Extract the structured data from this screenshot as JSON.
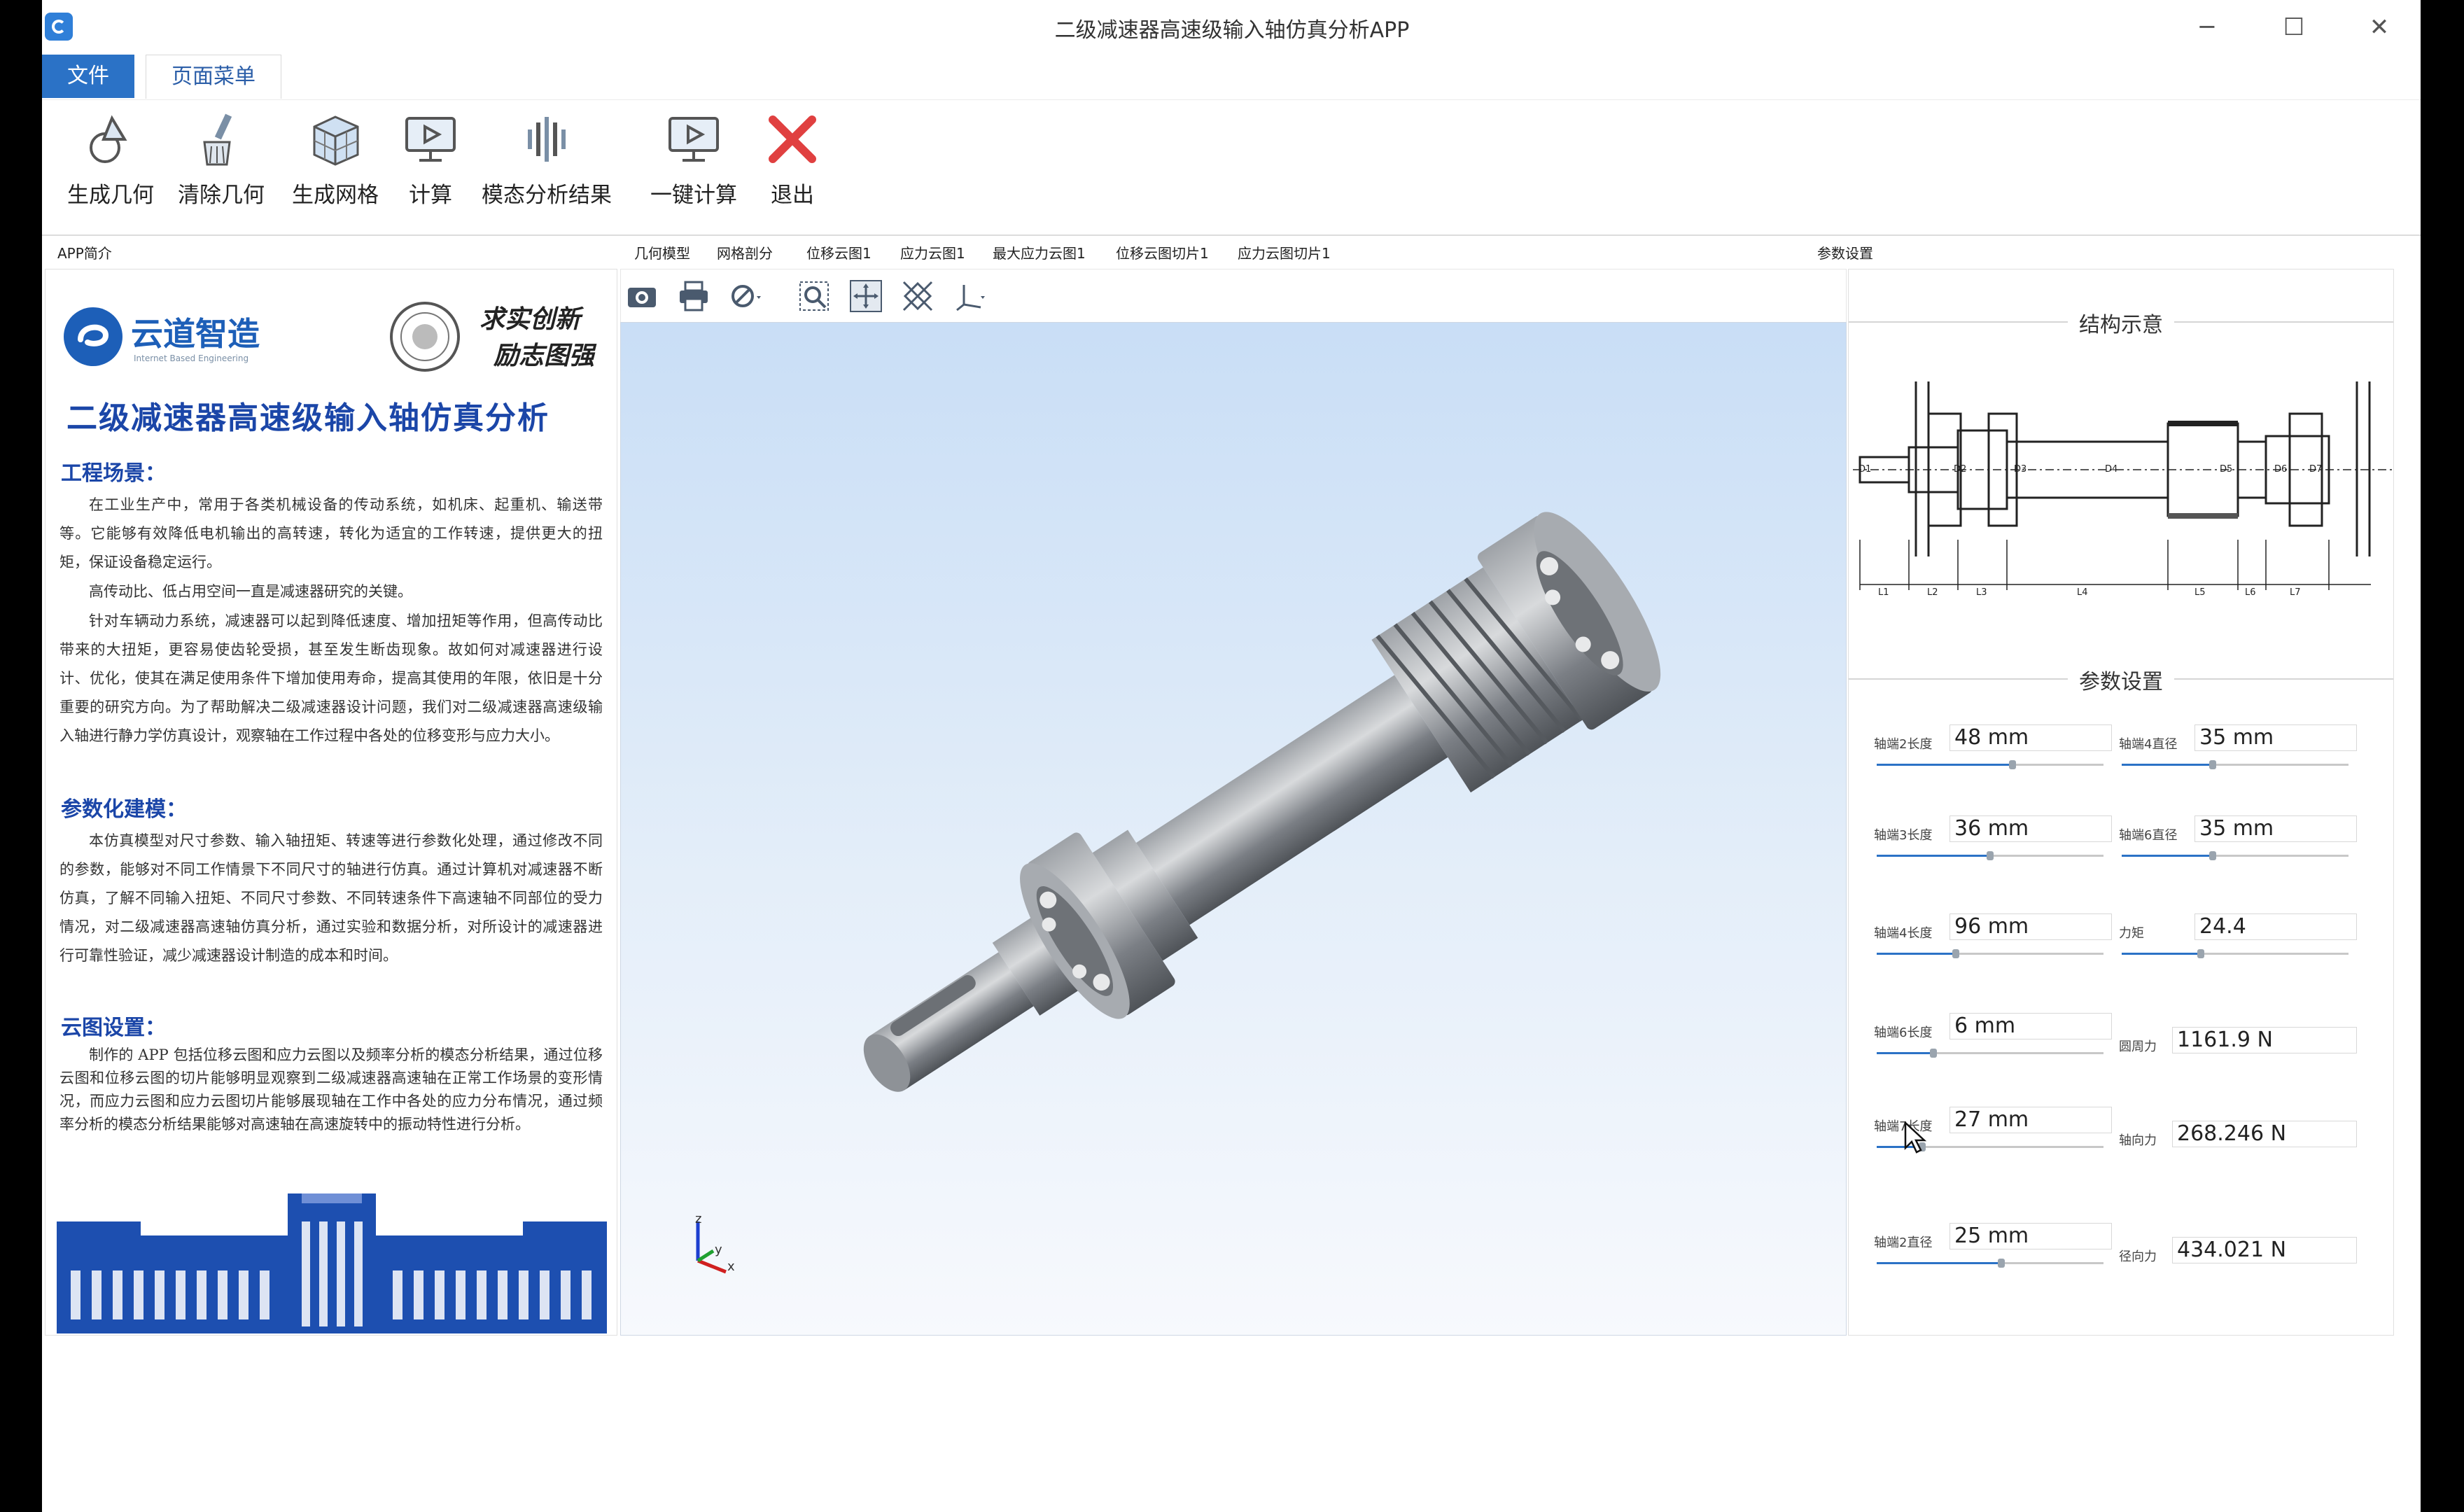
{
  "window": {
    "title": "二级减速器高速级输入轴仿真分析APP",
    "controls": {
      "minimize": "─",
      "maximize": "☐",
      "close": "✕"
    }
  },
  "menu": {
    "file": "文件",
    "page_menu": "页面菜单"
  },
  "ribbon": {
    "buttons": [
      {
        "label": "生成几何",
        "icon": "generate-geometry-icon"
      },
      {
        "label": "清除几何",
        "icon": "clear-geometry-icon"
      },
      {
        "label": "生成网格",
        "icon": "mesh-icon"
      },
      {
        "label": "计算",
        "icon": "compute-icon"
      },
      {
        "label": "模态分析结果",
        "icon": "modal-result-icon"
      },
      {
        "label": "一键计算",
        "icon": "one-click-compute-icon"
      },
      {
        "label": "退出",
        "icon": "exit-icon"
      }
    ]
  },
  "left_panel": {
    "header": "APP简介",
    "logo_text": "云道智造",
    "logo_sub": "Internet Based Engineering",
    "motto_line1": "求实创新",
    "motto_line2": "励志图强",
    "heading": "二级减速器高速级输入轴仿真分析",
    "sections": [
      {
        "title": "工程场景：",
        "paragraphs": [
          "在工业生产中，常用于各类机械设备的传动系统，如机床、起重机、输送带等。它能够有效降低电机输出的高转速，转化为适宜的工作转速，提供更大的扭矩，保证设备稳定运行。",
          "高传动比、低占用空间一直是减速器研究的关键。",
          "针对车辆动力系统，减速器可以起到降低速度、增加扭矩等作用，但高传动比带来的大扭矩，更容易使齿轮受损，甚至发生断齿现象。故如何对减速器进行设计、优化，使其在满足使用条件下增加使用寿命，提高其使用的年限，依旧是十分重要的研究方向。为了帮助解决二级减速器设计问题，我们对二级减速器高速级输入轴进行静力学仿真设计，观察轴在工作过程中各处的位移变形与应力大小。"
        ]
      },
      {
        "title": "参数化建模：",
        "paragraphs": [
          "本仿真模型对尺寸参数、输入轴扭矩、转速等进行参数化处理，通过修改不同的参数，能够对不同工作情景下不同尺寸的轴进行仿真。通过计算机对减速器不断仿真，了解不同输入扭矩、不同尺寸参数、不同转速条件下高速轴不同部位的受力情况，对二级减速器高速轴仿真分析，通过实验和数据分析，对所设计的减速器进行可靠性验证，减少减速器设计制造的成本和时间。"
        ]
      },
      {
        "title": "云图设置：",
        "paragraphs": [
          "制作的 APP 包括位移云图和应力云图以及频率分析的模态分析结果，通过位移云图和位移云图的切片能够明显观察到二级减速器高速轴在正常工作场景的变形情况，而应力云图和应力云图切片能够展现轴在工作中各处的应力分布情况，通过频率分析的模态分析结果能够对高速轴在高速旋转中的振动特性进行分析。"
        ]
      }
    ]
  },
  "viewport": {
    "tabs": [
      "几何模型",
      "网格剖分",
      "位移云图1",
      "应力云图1",
      "最大应力云图1",
      "位移云图切片1",
      "应力云图切片1"
    ],
    "toolbar_icons": [
      "camera-icon",
      "print-icon",
      "hide-icon",
      "zoom-box-icon",
      "zoom-extents-icon",
      "fit-view-icon",
      "axis-view-icon"
    ],
    "axis_labels": {
      "z": "z",
      "y": "y",
      "x": "x"
    }
  },
  "right_panel": {
    "header": "参数设置",
    "structure_title": "结构示意",
    "params_title": "参数设置",
    "diagram_labels": {
      "diameters": [
        "D1",
        "D2",
        "D3",
        "D4",
        "D5",
        "D6",
        "D7"
      ],
      "lengths": [
        "L1",
        "L2",
        "L3",
        "L4",
        "L5",
        "L6",
        "L7"
      ]
    },
    "params": [
      {
        "label": "轴端2长度",
        "value": "48 mm",
        "slider": 0.6
      },
      {
        "label": "轴端4直径",
        "value": "35 mm",
        "slider": 0.4
      },
      {
        "label": "轴端3长度",
        "value": "36 mm",
        "slider": 0.5
      },
      {
        "label": "轴端6直径",
        "value": "35 mm",
        "slider": 0.4
      },
      {
        "label": "轴端4长度",
        "value": "96 mm",
        "slider": 0.35
      },
      {
        "label": "力矩",
        "value": "24.4",
        "slider": 0.35
      },
      {
        "label": "轴端6长度",
        "value": "6 mm",
        "slider": 0.25
      },
      {
        "label": "圆周力",
        "value": "1161.9 N",
        "slider": null
      },
      {
        "label": "轴端7长度",
        "value": "27 mm",
        "slider": 0.2
      },
      {
        "label": "轴向力",
        "value": "268.246 N",
        "slider": null
      },
      {
        "label": "轴端2直径",
        "value": "25 mm",
        "slider": 0.55
      },
      {
        "label": "径向力",
        "value": "434.021 N",
        "slider": null
      }
    ]
  },
  "colors": {
    "accent": "#2b72c6",
    "heading": "#1b46a8",
    "exit_red": "#e04040"
  }
}
